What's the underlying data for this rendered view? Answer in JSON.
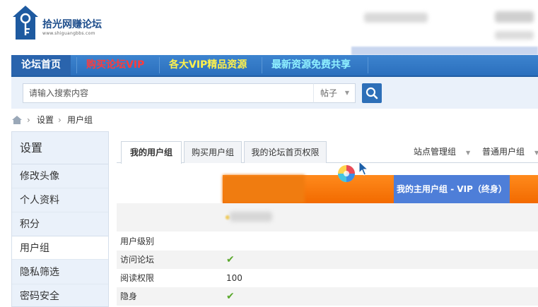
{
  "header": {
    "logo": {
      "title": "拾光网赚论坛",
      "subtitle": "www.shiguangbbs.com"
    }
  },
  "nav": {
    "items": [
      {
        "label": "论坛首页"
      },
      {
        "label": "购买论坛VIP"
      },
      {
        "label": "各大VIP精品资源"
      },
      {
        "label": "最新资源免费共享"
      }
    ]
  },
  "search": {
    "placeholder": "请输入搜索内容",
    "type_selected": "帖子"
  },
  "breadcrumb": {
    "items": [
      "设置",
      "用户组"
    ]
  },
  "sidebar": {
    "title": "设置",
    "items": [
      {
        "label": "修改头像"
      },
      {
        "label": "个人资料"
      },
      {
        "label": "积分"
      },
      {
        "label": "用户组"
      },
      {
        "label": "隐私筛选"
      },
      {
        "label": "密码安全"
      }
    ]
  },
  "tabs": {
    "items": [
      {
        "label": "我的用户组"
      },
      {
        "label": "购买用户组"
      },
      {
        "label": "我的论坛首页权限"
      }
    ],
    "dropdowns": [
      {
        "label": "站点管理组"
      },
      {
        "label": "普通用户组"
      }
    ]
  },
  "table": {
    "main_group_header": "我的主用户组 - VIP（终身）",
    "rows": [
      {
        "label": "用户级别",
        "value": ""
      },
      {
        "label": "访问论坛",
        "value": "✔"
      },
      {
        "label": "阅读权限",
        "value": "100"
      },
      {
        "label": "隐身",
        "value": "✔"
      }
    ]
  },
  "colors": {
    "nav_bg": "#2b6fbd",
    "nav_vip": "#ff3b3b",
    "nav_resources": "#fff14b",
    "nav_free": "#8ff0ff",
    "orange": "#f26a00",
    "vip_header": "#4e7ed8",
    "check": "#5aa82c"
  }
}
